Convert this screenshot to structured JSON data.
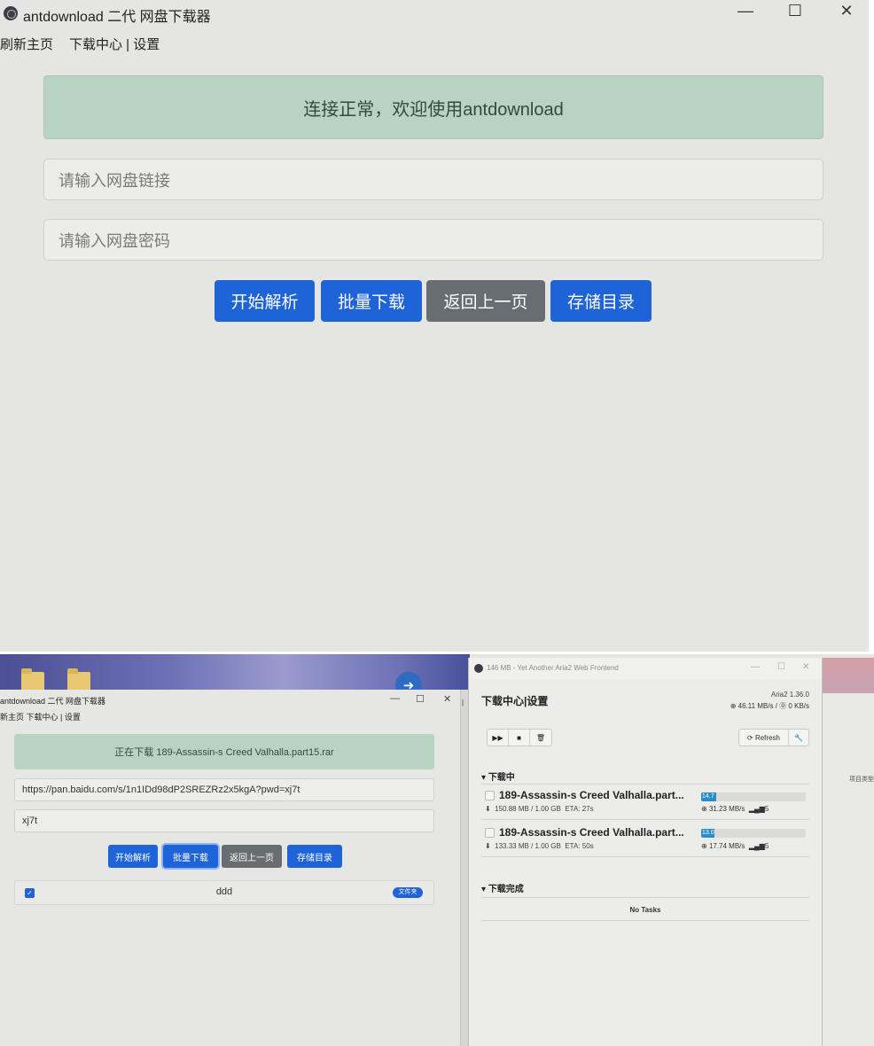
{
  "app": {
    "title": "antdownload 二代 网盘下载器",
    "window_controls": {
      "minimize": "—",
      "maximize": "☐",
      "close": "✕"
    },
    "menu": {
      "refresh_home": "刷新主页",
      "downloads_settings": "下载中心 | 设置"
    }
  },
  "main": {
    "status_alert": "连接正常，欢迎使用antdownload",
    "link_input": {
      "placeholder": "请输入网盘链接",
      "value": ""
    },
    "password_input": {
      "placeholder": "请输入网盘密码",
      "value": ""
    },
    "buttons": {
      "parse": "开始解析",
      "batch": "批量下载",
      "back": "返回上一页",
      "storage": "存储目录"
    },
    "colors": {
      "primary": "#1f63d9",
      "secondary": "#686d71",
      "alert_bg": "#b8d3c2"
    }
  },
  "screenshot": {
    "small_window": {
      "title": "antdownload 二代 网盘下载器",
      "menu": "新主页  下载中心 | 设置",
      "window_controls": {
        "minimize": "—",
        "maximize": "☐",
        "close": "✕"
      },
      "status_alert": "正在下载 189-Assassin-s Creed Valhalla.part15.rar",
      "link_value": "https://pan.baidu.com/s/1n1IDd98dP2SREZRz2x5kgA?pwd=xj7t",
      "password_value": "xj7t",
      "buttons": {
        "parse": "开始解析",
        "batch": "批量下载",
        "back": "返回上一页",
        "storage": "存储目录"
      },
      "file_row": {
        "name": "ddd",
        "badge": "文件夹",
        "checked": true
      }
    },
    "aria": {
      "window_title": "146 MB - Yet Another Aria2 Web Frontend",
      "header": "下载中心|设置",
      "version": "Aria2 1.36.0",
      "global_speed": "46.11 MB/s / ⓪ 0 KB/s",
      "refresh_label": "Refresh",
      "downloading_heading": "下载中",
      "completed_heading": "下载完成",
      "no_tasks": "No Tasks",
      "tasks": [
        {
          "name": "189-Assassin-s Creed Valhalla.part...",
          "size": "150.88 MB / 1.00 GB",
          "eta": "ETA: 27s",
          "progress_pct": 14.7,
          "progress_label": "14.7",
          "speed": "31.23 MB/s",
          "connections": "5"
        },
        {
          "name": "189-Assassin-s Creed Valhalla.part...",
          "size": "133.33 MB / 1.00 GB",
          "eta": "ETA: 50s",
          "progress_pct": 13.0,
          "progress_label": "13.0",
          "speed": "17.74 MB/s",
          "connections": "5"
        }
      ]
    },
    "side_fragment": {
      "label": "项目类型"
    }
  }
}
